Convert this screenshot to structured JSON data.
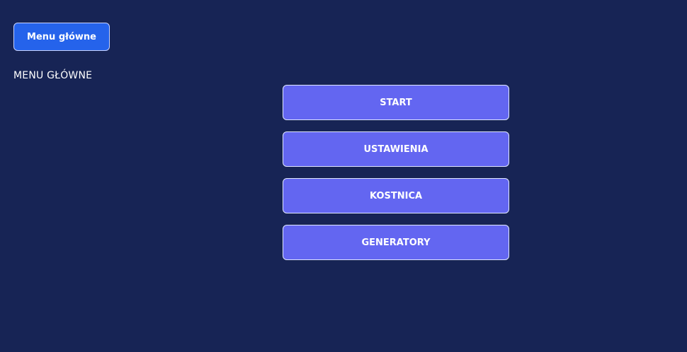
{
  "header": {
    "main_menu_button_label": "Menu główne",
    "title": "MENU GŁÓWNE"
  },
  "menu": {
    "items": [
      {
        "label": "START"
      },
      {
        "label": "USTAWIENIA"
      },
      {
        "label": "KOSTNICA"
      },
      {
        "label": "GENERATORY"
      }
    ]
  },
  "colors": {
    "background": "#172455",
    "primary_button": "#2563eb",
    "menu_button": "#6366f1",
    "text": "#ffffff"
  }
}
